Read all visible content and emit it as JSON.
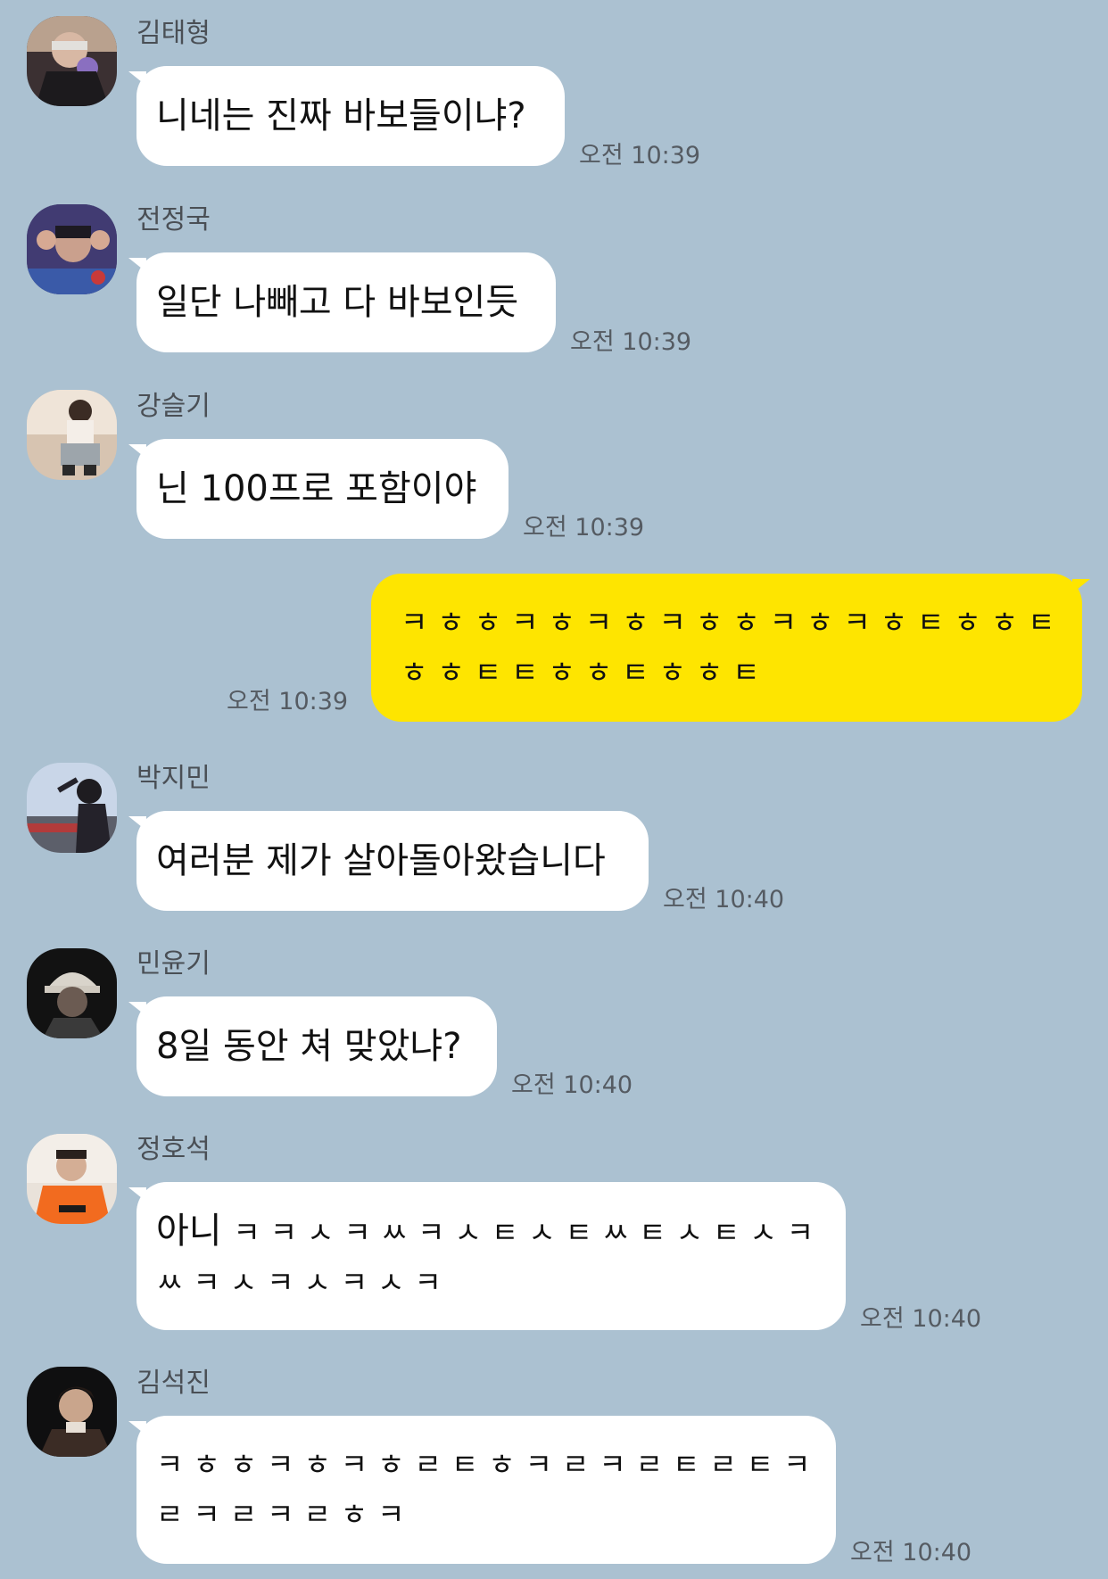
{
  "colors": {
    "background": "#abc1d1",
    "incoming_bubble": "#ffffff",
    "outgoing_bubble": "#fee500"
  },
  "messages": [
    {
      "sender": "김태형",
      "avatar_icon": "profile-photo-icon",
      "lines": [
        "니네는 진짜 바보들이냐?"
      ],
      "time": "오전 10:39",
      "direction": "incoming"
    },
    {
      "sender": "전정국",
      "avatar_icon": "profile-photo-icon",
      "lines": [
        "일단 나빼고 다 바보인듯"
      ],
      "time": "오전 10:39",
      "direction": "incoming"
    },
    {
      "sender": "강슬기",
      "avatar_icon": "profile-photo-icon",
      "lines": [
        "닌 100프로 포함이야"
      ],
      "time": "오전 10:39",
      "direction": "incoming"
    },
    {
      "sender": "",
      "lines": [
        "ㅋㅎㅎㅋㅎㅋㅎㅋㅎㅎㅋㅎㅋㅎㅌㅎㅎㅌ",
        "ㅎㅎㅌㅌㅎㅎㅌㅎㅎㅌ"
      ],
      "time": "오전 10:39",
      "direction": "outgoing"
    },
    {
      "sender": "박지민",
      "avatar_icon": "profile-photo-icon",
      "lines": [
        "여러분 제가 살아돌아왔습니다"
      ],
      "time": "오전 10:40",
      "direction": "incoming"
    },
    {
      "sender": "민윤기",
      "avatar_icon": "profile-photo-icon",
      "lines": [
        "8일 동안 쳐 맞았냐?"
      ],
      "time": "오전 10:40",
      "direction": "incoming"
    },
    {
      "sender": "정호석",
      "avatar_icon": "profile-photo-icon",
      "lines_first_word": "아니",
      "lines": [
        "ㅋㅋㅅㅋㅆㅋㅅㅌㅅㅌㅆㅌㅅㅌㅅㅋ",
        "ㅆㅋㅅㅋㅅㅋㅅㅋ"
      ],
      "time": "오전 10:40",
      "direction": "incoming"
    },
    {
      "sender": "김석진",
      "avatar_icon": "profile-photo-icon",
      "lines": [
        "ㅋㅎㅎㅋㅎㅋㅎㄹㅌㅎㅋㄹㅋㄹㅌㄹㅌㅋ",
        "ㄹㅋㄹㅋㄹㅎㅋ"
      ],
      "time": "오전 10:40",
      "direction": "incoming"
    }
  ]
}
